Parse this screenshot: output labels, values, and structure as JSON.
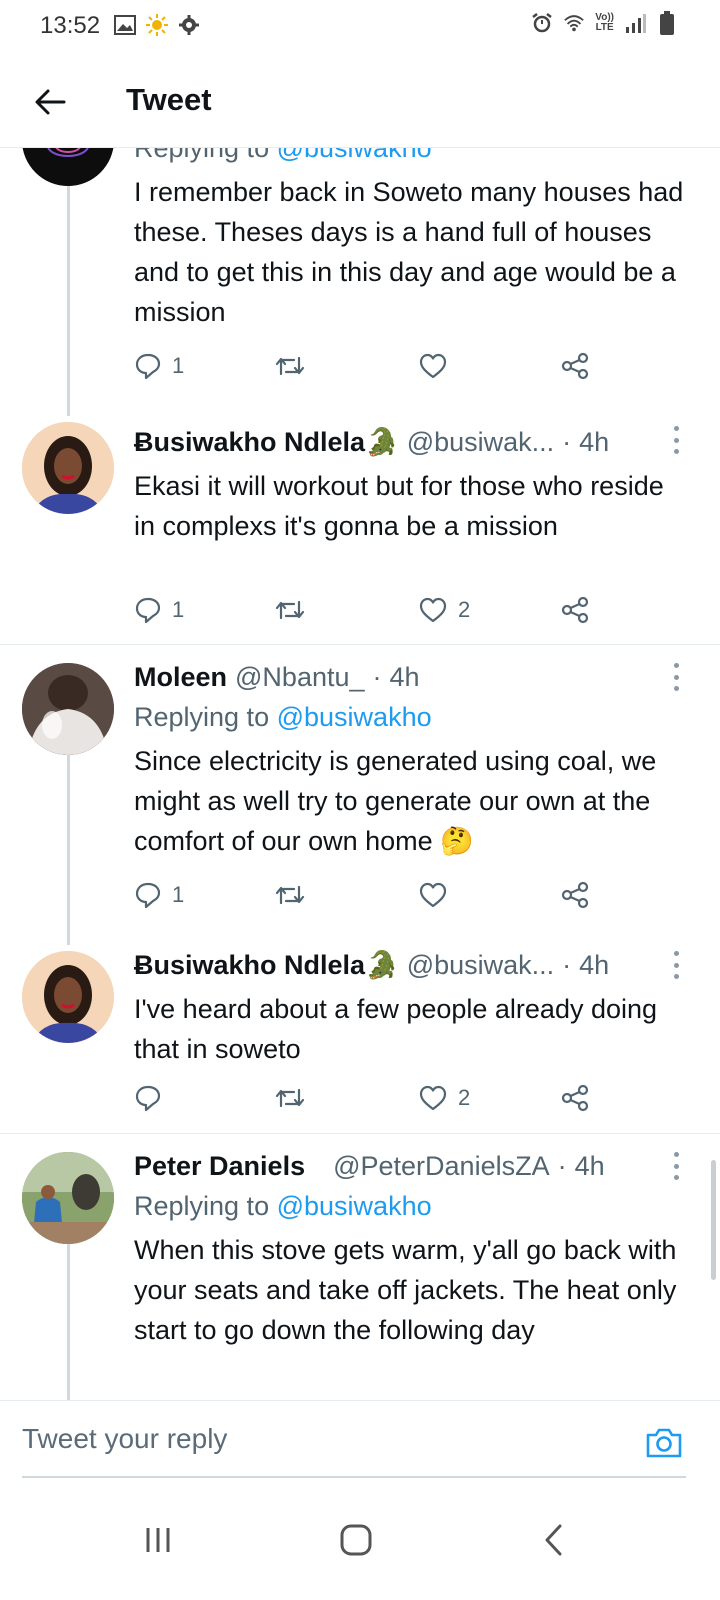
{
  "status_bar": {
    "time": "13:52",
    "left_icons": [
      "gallery-icon",
      "sun-icon",
      "gear-icon"
    ],
    "right_icons": [
      "alarm-icon",
      "wifi-icon",
      "volte-icon",
      "signal-icon",
      "battery-icon"
    ],
    "volte_label": "Vo))\nLTE"
  },
  "header": {
    "title": "Tweet"
  },
  "tweets": [
    {
      "replying_prefix": "Replying to",
      "replying_to": "@busiwakho",
      "text": "I remember back in Soweto many houses had these. Theses days is a hand full of houses and to get this in this day and age would be a mission",
      "replies": "1",
      "retweets": "",
      "likes": ""
    },
    {
      "name": "Ƀusiwakho Ndlela🐊",
      "handle": "@busiwak...",
      "dot": "·",
      "time": "4h",
      "text": "Ekasi it will workout but for those who reside in complexs it's gonna be a mission",
      "replies": "1",
      "retweets": "",
      "likes": "2"
    },
    {
      "name": "Moleen",
      "handle": "@Nbantu_",
      "dot": "·",
      "time": "4h",
      "replying_prefix": "Replying to",
      "replying_to": "@busiwakho",
      "text": "Since electricity is generated using coal, we might as well try to generate our own at the comfort of our own home 🤔",
      "replies": "1",
      "retweets": "",
      "likes": ""
    },
    {
      "name": "Ƀusiwakho Ndlela🐊",
      "handle": "@busiwak...",
      "dot": "·",
      "time": "4h",
      "text": "I've heard about a few people already doing that in soweto",
      "replies": "",
      "retweets": "",
      "likes": "2"
    },
    {
      "name": "Peter Daniels",
      "handle": "@PeterDanielsZA",
      "dot": "·",
      "time": "4h",
      "replying_prefix": "Replying to",
      "replying_to": "@busiwakho",
      "text": "When this stove gets warm, y'all go back with your seats and take off jackets. The heat only start to go down the following day"
    }
  ],
  "reply_bar": {
    "placeholder": "Tweet your reply"
  },
  "nav": {
    "buttons": [
      "recent-apps-icon",
      "home-icon",
      "back-icon"
    ]
  },
  "colors": {
    "accent": "#1d9bf0",
    "secondary_text": "#536471",
    "thread_line": "#cfd9de"
  }
}
